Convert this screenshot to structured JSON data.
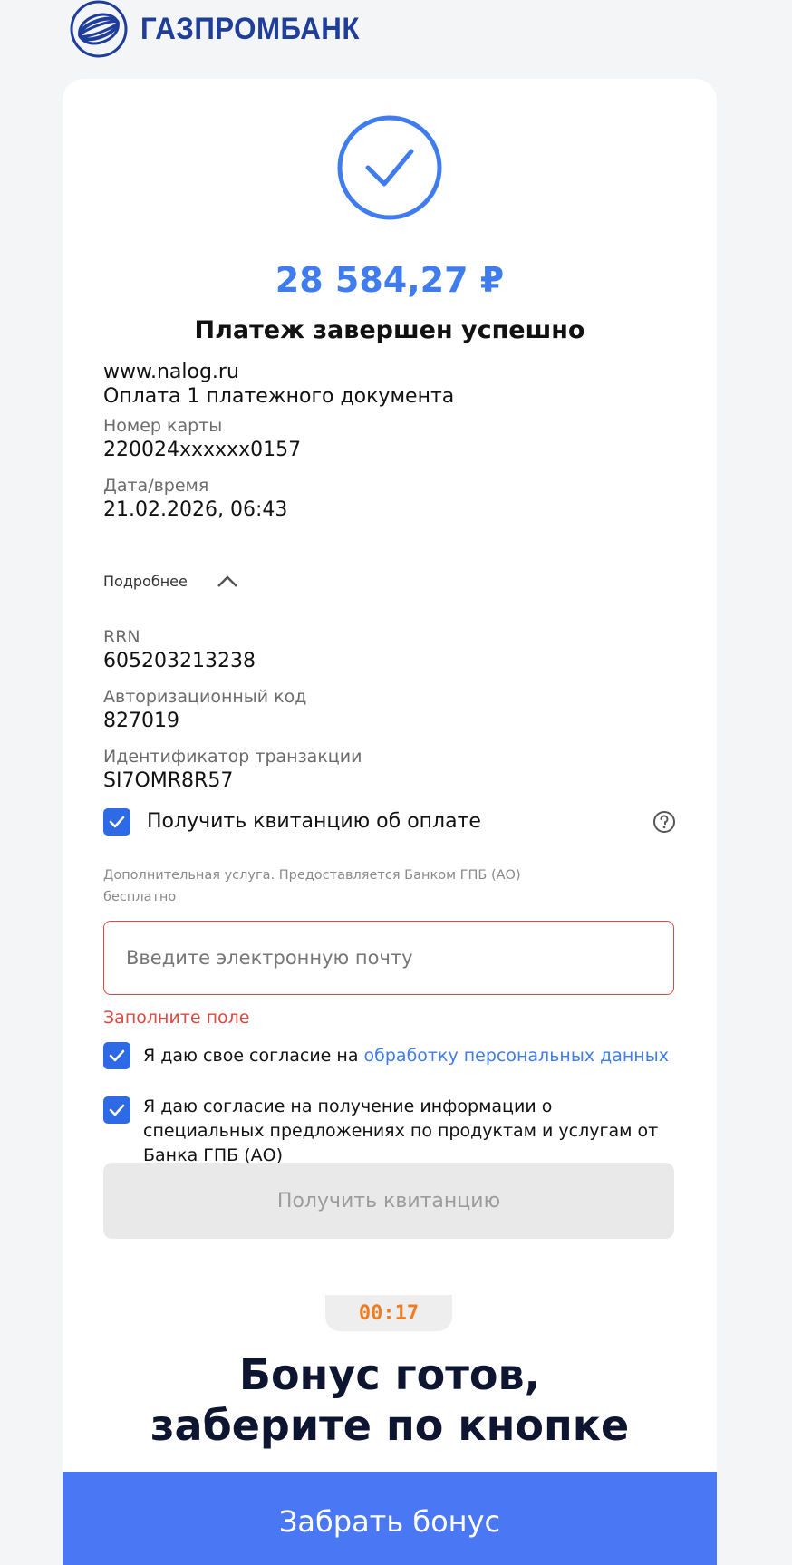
{
  "brand": {
    "name": "ГАЗПРОМБАНК",
    "logo_icon": "gazprombank-globe-logo",
    "color": "#1f3d9a"
  },
  "status": {
    "icon": "check-circle-icon",
    "amount": "28 584,27 ₽",
    "title": "Платеж завершен успешно",
    "accent": "#3e7cf0"
  },
  "payment": {
    "merchant": "www.nalog.ru",
    "description": "Оплата 1 платежного документа",
    "card_label": "Номер карты",
    "card_value": "220024xxxxxx0157",
    "date_label": "Дата/время",
    "date_value": "21.02.2026, 06:43"
  },
  "details_toggle": {
    "label": "Подробнее",
    "icon": "chevron-up-icon"
  },
  "details": {
    "rrn_label": "RRN",
    "rrn_value": "605203213238",
    "auth_label": "Авторизационный код",
    "auth_value": "827019",
    "txn_label": "Идентификатор транзакции",
    "txn_value": "SI7OMR8R57"
  },
  "receipt": {
    "checkbox_label": "Получить квитанцию об оплате",
    "checked": true,
    "help_icon": "question-circle-icon",
    "note": "Дополнительная услуга. Предоставляется Банком ГПБ (АО) бесплатно",
    "email_placeholder": "Введите электронную почту",
    "email_value": "",
    "error": "Заполните поле",
    "error_color": "#e0473e",
    "consent1_text": "Я даю свое согласие на ",
    "consent1_link": "обработку персональных данных",
    "consent2_text": "Я даю согласие на получение информации о специальных предложениях по продуктам и услугам от Банка ГПБ (АО)",
    "submit_label": "Получить квитанцию"
  },
  "bonus": {
    "timer": "00:17",
    "timer_color": "#f07c22",
    "title_line1": "Бонус готов,",
    "title_line2": "заберите по кнопке",
    "button_label": "Забрать бонус",
    "button_color": "#4a78f5"
  }
}
